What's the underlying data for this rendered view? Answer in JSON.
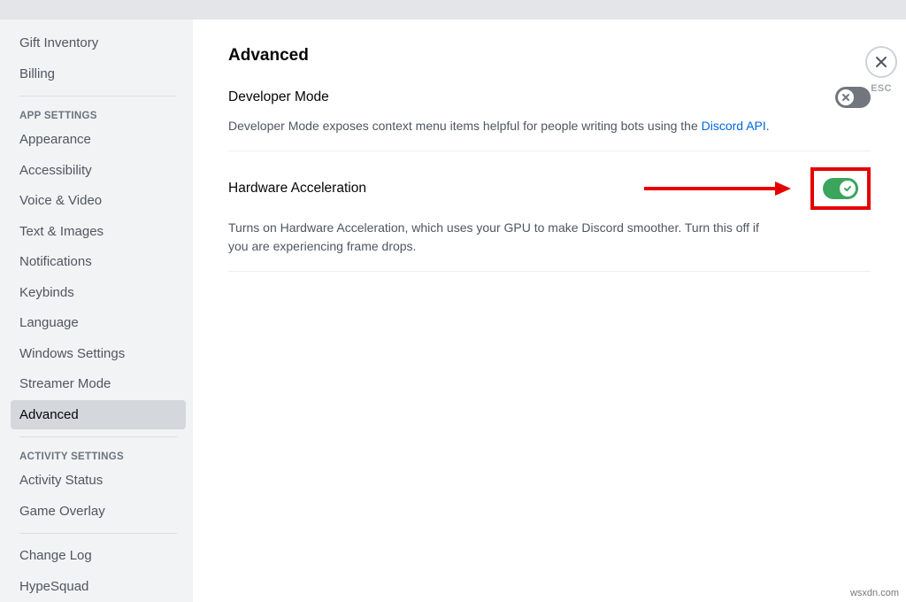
{
  "sidebar": {
    "top_items": [
      {
        "label": "Gift Inventory"
      },
      {
        "label": "Billing"
      }
    ],
    "app_settings_header": "APP SETTINGS",
    "app_items": [
      {
        "label": "Appearance"
      },
      {
        "label": "Accessibility"
      },
      {
        "label": "Voice & Video"
      },
      {
        "label": "Text & Images"
      },
      {
        "label": "Notifications"
      },
      {
        "label": "Keybinds"
      },
      {
        "label": "Language"
      },
      {
        "label": "Windows Settings"
      },
      {
        "label": "Streamer Mode"
      },
      {
        "label": "Advanced",
        "selected": true
      }
    ],
    "activity_settings_header": "ACTIVITY SETTINGS",
    "activity_items": [
      {
        "label": "Activity Status"
      },
      {
        "label": "Game Overlay"
      }
    ],
    "bottom_items": [
      {
        "label": "Change Log"
      },
      {
        "label": "HypeSquad"
      }
    ]
  },
  "page": {
    "title": "Advanced",
    "close_label": "ESC"
  },
  "settings": {
    "developer_mode": {
      "title": "Developer Mode",
      "desc_prefix": "Developer Mode exposes context menu items helpful for people writing bots using the ",
      "desc_link": "Discord API",
      "desc_suffix": ".",
      "enabled": false
    },
    "hardware_accel": {
      "title": "Hardware Acceleration",
      "desc": "Turns on Hardware Acceleration, which uses your GPU to make Discord smoother. Turn this off if you are experiencing frame drops.",
      "enabled": true
    }
  },
  "watermark": "wsxdn.com"
}
